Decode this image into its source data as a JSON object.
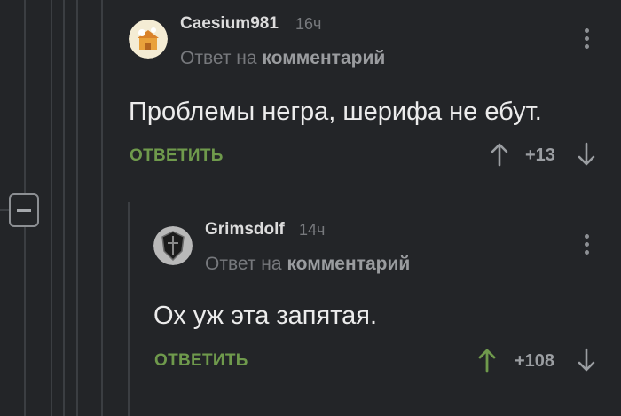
{
  "comments": [
    {
      "username": "Caesium981",
      "time": "16ч",
      "reply_prefix": "Ответ на",
      "reply_link": "комментарий",
      "text": "Проблемы негра, шерифа не ебут.",
      "reply_button": "ОТВЕТИТЬ",
      "score": "+13",
      "upvoted": false
    },
    {
      "username": "Grimsdolf",
      "time": "14ч",
      "reply_prefix": "Ответ на",
      "reply_link": "комментарий",
      "text": "Ох уж эта запятая.",
      "reply_button": "ОТВЕТИТЬ",
      "score": "+108",
      "upvoted": true
    }
  ],
  "colors": {
    "background": "#232528",
    "accent_green": "#6f9a4c",
    "muted_text": "#77797d"
  },
  "icons": [
    "collapse-thread-icon",
    "more-vertical-icon",
    "arrow-up-icon",
    "arrow-down-icon"
  ]
}
